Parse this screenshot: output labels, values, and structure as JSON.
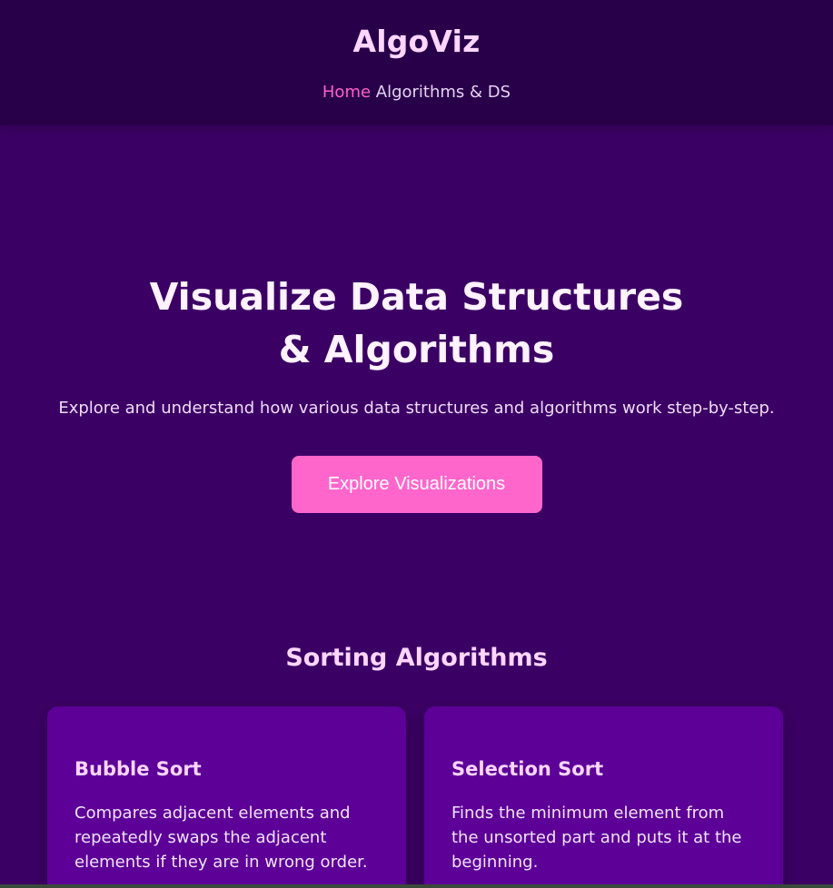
{
  "header": {
    "brand": "AlgoViz",
    "nav": {
      "home": "Home",
      "algorithms": "Algorithms & DS"
    }
  },
  "hero": {
    "title": "Visualize Data Structures & Algorithms",
    "subtitle": "Explore and understand how various data structures and algorithms work step-by-step.",
    "cta_label": "Explore Visualizations"
  },
  "sorting": {
    "title": "Sorting Algorithms",
    "cards": [
      {
        "title": "Bubble Sort",
        "description": "Compares adjacent elements and repeatedly swaps the adjacent elements if they are in wrong order."
      },
      {
        "title": "Selection Sort",
        "description": "Finds the minimum element from the unsorted part and puts it at the beginning."
      }
    ]
  },
  "colors": {
    "header_bg": "#28004a",
    "page_bg": "#3b0064",
    "accent": "#ff66cc",
    "card_bg": "#5c0097",
    "brand_text": "#ffd6ff"
  }
}
